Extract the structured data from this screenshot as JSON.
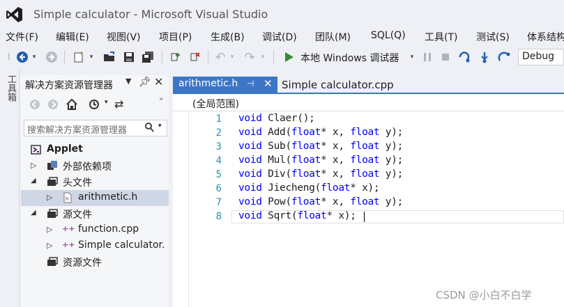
{
  "window": {
    "title": "Simple calculator - Microsoft Visual Studio"
  },
  "menu": [
    "文件(F)",
    "编辑(E)",
    "视图(V)",
    "项目(P)",
    "生成(B)",
    "调试(D)",
    "团队(M)",
    "SQL(Q)",
    "工具(T)",
    "测试(S)",
    "体系结构"
  ],
  "toolbar": {
    "run_label": "本地 Windows 调试器",
    "config": "Debug"
  },
  "toolbox": {
    "label": "工具箱"
  },
  "solution_explorer": {
    "title": "解决方案资源管理器",
    "search_placeholder": "搜索解决方案资源管理器",
    "tree": [
      {
        "label": "Applet",
        "level": 0,
        "bold": true,
        "selected": false
      },
      {
        "label": "外部依赖项",
        "level": 1,
        "selected": false
      },
      {
        "label": "头文件",
        "level": 1,
        "selected": false
      },
      {
        "label": "arithmetic.h",
        "level": 2,
        "selected": true
      },
      {
        "label": "源文件",
        "level": 1,
        "selected": false
      },
      {
        "label": "function.cpp",
        "level": 2,
        "selected": false
      },
      {
        "label": "Simple calculator.",
        "level": 2,
        "selected": false
      },
      {
        "label": "资源文件",
        "level": 1,
        "selected": false
      }
    ]
  },
  "tabs": {
    "active": "arithmetic.h",
    "inactive": "Simple calculator.cpp"
  },
  "scope": "(全局范围)",
  "code_lines": [
    {
      "no": "1",
      "text": "void Claer();"
    },
    {
      "no": "2",
      "text": "void Add(float* x, float y);"
    },
    {
      "no": "3",
      "text": "void Sub(float* x, float y);"
    },
    {
      "no": "4",
      "text": "void Mul(float* x, float y);"
    },
    {
      "no": "5",
      "text": "void Div(float* x, float y);"
    },
    {
      "no": "6",
      "text": "void Jiecheng(float* x);"
    },
    {
      "no": "7",
      "text": "void Pow(float* x, float y);"
    },
    {
      "no": "8",
      "text": "void Sqrt(float* x);"
    }
  ],
  "watermark": "CSDN @小白不白学",
  "colors": {
    "accent": "#3e76c7",
    "keyword": "#0000ff",
    "line_number": "#2b91af",
    "vs_purple": "#68217a"
  }
}
